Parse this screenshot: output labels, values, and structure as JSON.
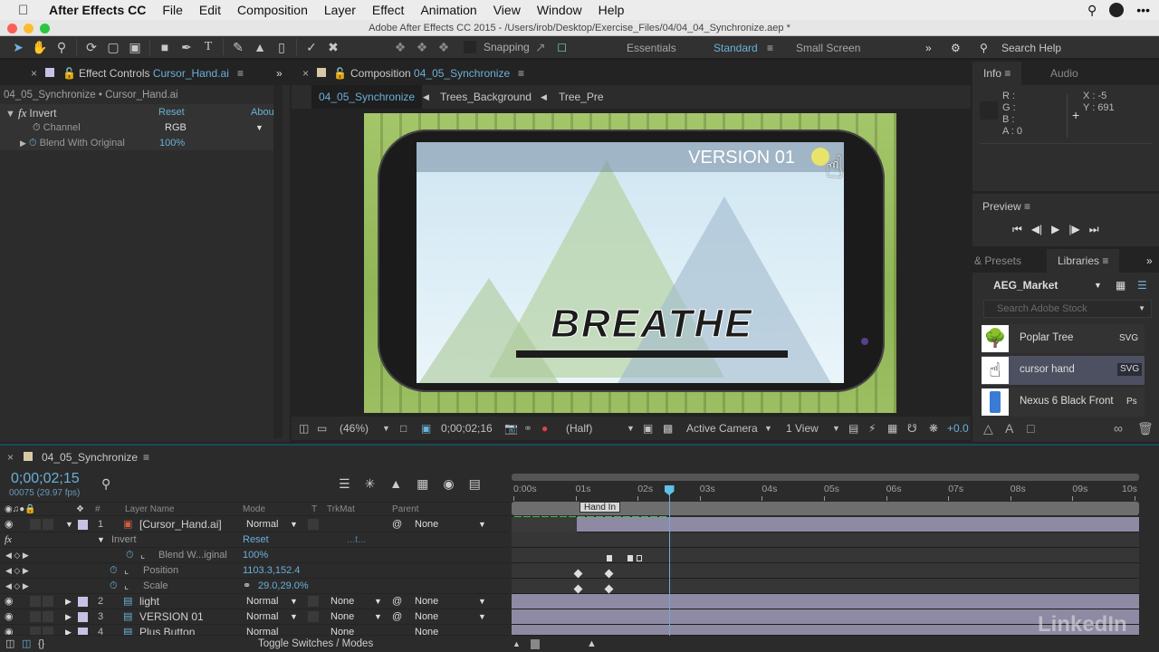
{
  "menubar": {
    "app_name": "After Effects CC",
    "items": [
      "File",
      "Edit",
      "Composition",
      "Layer",
      "Effect",
      "Animation",
      "View",
      "Window",
      "Help"
    ]
  },
  "window_title": "Adobe After Effects CC 2015 - /Users/irob/Desktop/Exercise_Files/04/04_04_Synchronize.aep *",
  "toolbar": {
    "tools": [
      "selection-tool",
      "hand-tool",
      "zoom-tool",
      "rotation-tool",
      "camera-tool",
      "pan-behind-tool",
      "rectangle-tool",
      "pen-tool",
      "type-tool",
      "brush-tool",
      "clone-stamp-tool",
      "eraser-tool",
      "roto-brush-tool",
      "puppet-pin-tool"
    ],
    "snapping_label": "Snapping",
    "workspaces": [
      "Essentials",
      "Standard",
      "Small Screen"
    ],
    "active_workspace": "Standard",
    "search_help_label": "Search Help"
  },
  "effect_controls": {
    "tab_prefix": "Effect Controls",
    "tab_layer": "Cursor_Hand.ai",
    "breadcrumb": "04_05_Synchronize • Cursor_Hand.ai",
    "effect_name": "Invert",
    "reset_label": "Reset",
    "about_label": "Abou",
    "channel_label": "Channel",
    "channel_value": "RGB",
    "blend_label": "Blend With Original",
    "blend_value": "100%"
  },
  "composition": {
    "tab_prefix": "Composition",
    "tab_name": "04_05_Synchronize",
    "breadcrumbs": [
      "04_05_Synchronize",
      "Trees_Background",
      "Tree_Pre"
    ],
    "viewer": {
      "version_text": "VERSION 01",
      "title_text": "BREATHE"
    },
    "footer": {
      "zoom": "(46%)",
      "timecode": "0;00;02;16",
      "resolution": "(Half)",
      "camera": "Active Camera",
      "views": "1 View",
      "exposure": "+0.0"
    }
  },
  "info_panel": {
    "tabs": [
      "Info",
      "Audio"
    ],
    "r": "R :",
    "g": "G :",
    "b": "B :",
    "a": "A : 0",
    "x": "X : -5",
    "y": "Y : 691"
  },
  "preview_panel": {
    "title": "Preview",
    "controls": [
      "first-frame",
      "previous-frame",
      "play",
      "next-frame",
      "last-frame"
    ]
  },
  "libraries_panel": {
    "tabs": [
      "& Presets",
      "Libraries"
    ],
    "library_name": "AEG_Market",
    "search_placeholder": "Search Adobe Stock",
    "items": [
      {
        "name": "Poplar Tree",
        "type": "SVG"
      },
      {
        "name": "cursor hand",
        "type": "SVG",
        "selected": true
      },
      {
        "name": "Nexus 6 Black Front",
        "type": "Ps"
      }
    ]
  },
  "timeline": {
    "tab_name": "04_05_Synchronize",
    "timecode": "0;00;02;15",
    "frame_info": "00075 (29.97 fps)",
    "columns": {
      "num": "#",
      "layer_name": "Layer Name",
      "mode": "Mode",
      "t": "T",
      "trkmat": "TrkMat",
      "parent": "Parent"
    },
    "rows": [
      {
        "type": "layer",
        "num": "1",
        "name": "[Cursor_Hand.ai]",
        "mode": "Normal",
        "trkmat": "",
        "parent": "None",
        "expanded": true
      },
      {
        "type": "effect",
        "name": "Invert",
        "value": "Reset",
        "extra": "...t..."
      },
      {
        "type": "prop",
        "name": "Blend W...iginal",
        "value": "100%"
      },
      {
        "type": "prop",
        "name": "Position",
        "value": "1103.3,152.4"
      },
      {
        "type": "prop",
        "name": "Scale",
        "value": "29.0,29.0%"
      },
      {
        "type": "layer",
        "num": "2",
        "name": "light",
        "mode": "Normal",
        "trkmat": "None",
        "parent": "None"
      },
      {
        "type": "layer",
        "num": "3",
        "name": "VERSION 01",
        "mode": "Normal",
        "trkmat": "None",
        "parent": "None"
      },
      {
        "type": "layer",
        "num": "4",
        "name": "Plus Button",
        "mode": "Normal",
        "trkmat": "None",
        "parent": "None"
      }
    ],
    "ruler_ticks": [
      "0:00s",
      "01s",
      "02s",
      "03s",
      "04s",
      "05s",
      "06s",
      "07s",
      "08s",
      "09s",
      "10s"
    ],
    "marker_label": "Hand In",
    "toggle_label": "Toggle Switches / Modes",
    "playhead_seconds": 2.5
  },
  "watermark": "LinkedIn"
}
